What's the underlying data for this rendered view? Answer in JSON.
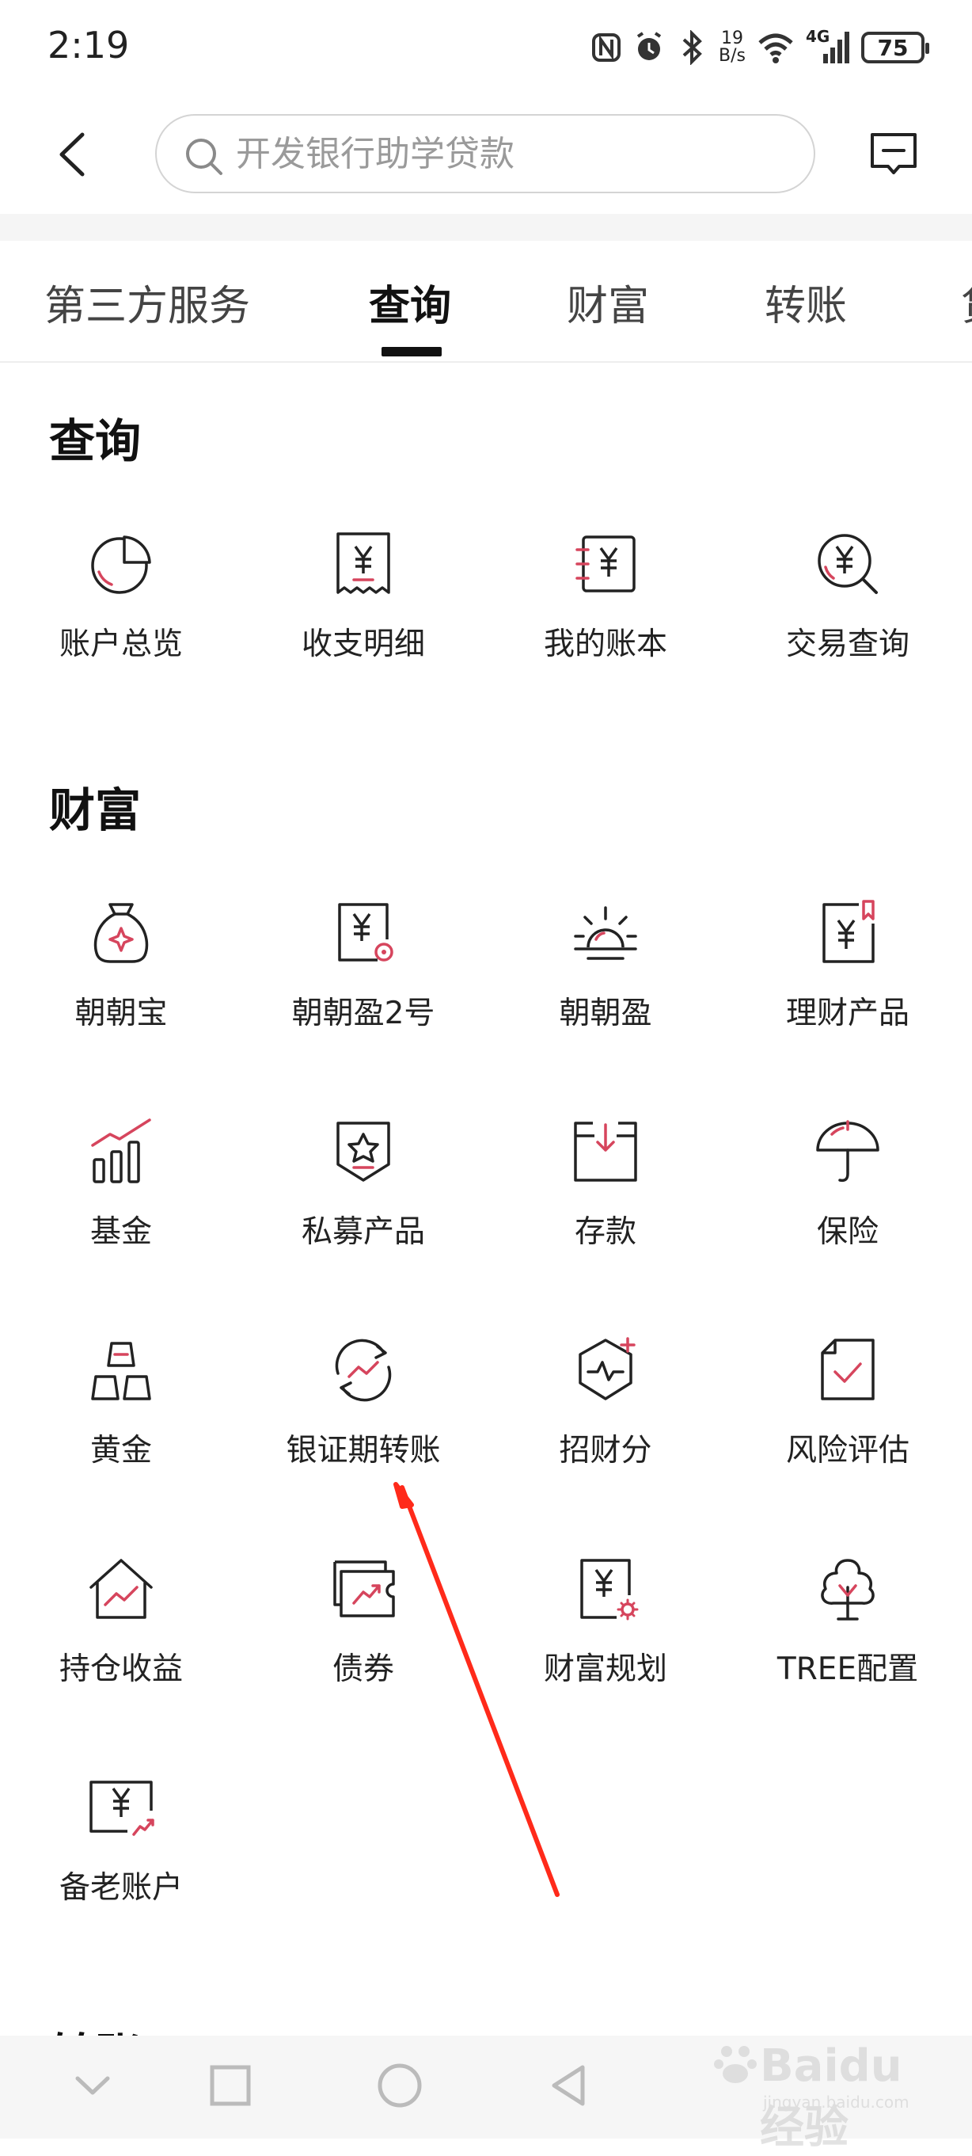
{
  "status_bar": {
    "time": "2:19",
    "net_speed_value": "19",
    "net_speed_unit": "B/s",
    "network": "4G",
    "battery": "75",
    "icons": [
      "nfc-icon",
      "alarm-icon",
      "bluetooth-icon",
      "wifi-icon",
      "signal-icon",
      "battery-icon"
    ]
  },
  "header": {
    "search_placeholder": "开发银行助学贷款",
    "icons": [
      "back-arrow-icon",
      "search-icon",
      "message-icon"
    ]
  },
  "tabs": [
    {
      "label": "第三方服务",
      "active": false
    },
    {
      "label": "查询",
      "active": true
    },
    {
      "label": "财富",
      "active": false
    },
    {
      "label": "转账",
      "active": false
    },
    {
      "label": "贷",
      "active": false
    }
  ],
  "sections": [
    {
      "title": "查询",
      "items": [
        {
          "label": "账户总览",
          "icon": "pie-chart-icon"
        },
        {
          "label": "收支明细",
          "icon": "receipt-yuan-icon"
        },
        {
          "label": "我的账本",
          "icon": "ledger-yuan-icon"
        },
        {
          "label": "交易查询",
          "icon": "yuan-search-icon"
        }
      ]
    },
    {
      "title": "财富",
      "items": [
        {
          "label": "朝朝宝",
          "icon": "money-bag-icon"
        },
        {
          "label": "朝朝盈2号",
          "icon": "yuan-card-icon"
        },
        {
          "label": "朝朝盈",
          "icon": "sunrise-icon"
        },
        {
          "label": "理财产品",
          "icon": "yuan-bookmark-icon"
        },
        {
          "label": "基金",
          "icon": "bar-trend-icon"
        },
        {
          "label": "私募产品",
          "icon": "star-shield-icon"
        },
        {
          "label": "存款",
          "icon": "deposit-box-icon"
        },
        {
          "label": "保险",
          "icon": "umbrella-icon"
        },
        {
          "label": "黄金",
          "icon": "gold-bars-icon"
        },
        {
          "label": "银证期转账",
          "icon": "exchange-circle-icon"
        },
        {
          "label": "招财分",
          "icon": "hexagon-pulse-icon"
        },
        {
          "label": "风险评估",
          "icon": "check-document-icon"
        },
        {
          "label": "持仓收益",
          "icon": "house-trend-icon"
        },
        {
          "label": "债券",
          "icon": "bond-ticket-icon"
        },
        {
          "label": "财富规划",
          "icon": "yuan-gear-icon"
        },
        {
          "label": "TREE配置",
          "icon": "tree-icon"
        },
        {
          "label": "备老账户",
          "icon": "yuan-trend-card-icon"
        }
      ]
    }
  ],
  "next_section_title": "转账",
  "nav_bar": {
    "icons": [
      "hide-keyboard-icon",
      "recents-icon",
      "home-icon",
      "back-icon"
    ]
  },
  "watermark": {
    "text": "Baidu经验",
    "sub": "jingyan.baidu.com"
  },
  "colors": {
    "accent": "#d6455d",
    "text": "#1a1a1a",
    "annotation_arrow": "#ff2a1a"
  }
}
